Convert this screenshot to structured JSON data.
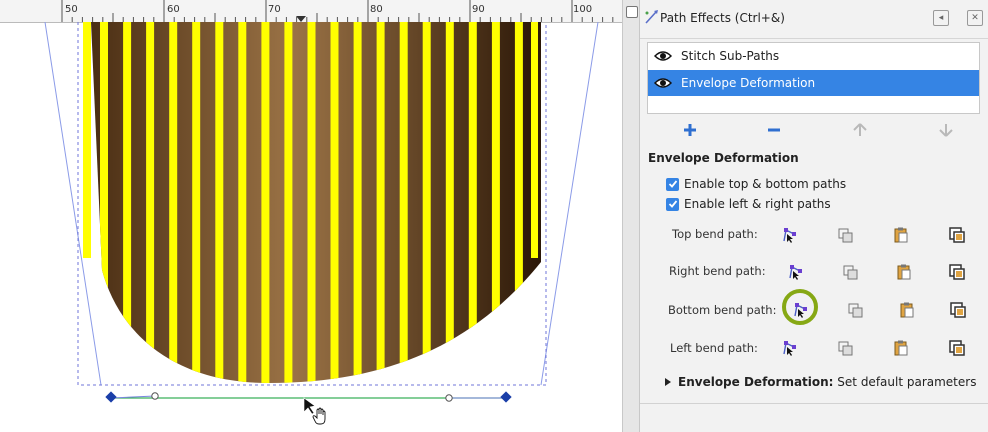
{
  "ruler": {
    "labels": [
      "50",
      "60",
      "70",
      "80",
      "90",
      "100"
    ]
  },
  "panel": {
    "title": "Path Effects (Ctrl+&)",
    "effects": [
      {
        "label": "Stitch Sub-Paths",
        "selected": false
      },
      {
        "label": "Envelope Deformation",
        "selected": true
      }
    ],
    "section_title": "Envelope Deformation",
    "checkboxes": [
      {
        "label": "Enable top & bottom paths",
        "checked": true
      },
      {
        "label": "Enable left & right paths",
        "checked": true
      }
    ],
    "bend_paths": [
      {
        "label": "Top bend path:"
      },
      {
        "label": "Right bend path:"
      },
      {
        "label": "Bottom bend path:"
      },
      {
        "label": "Left bend path:"
      }
    ],
    "expander": {
      "bold": "Envelope Deformation:",
      "rest": " Set default parameters"
    }
  },
  "colors": {
    "accent": "#3584e4",
    "stripes": "#ffff00",
    "highlight_ring": "#86a814",
    "bend_path": "#3ab15a"
  }
}
